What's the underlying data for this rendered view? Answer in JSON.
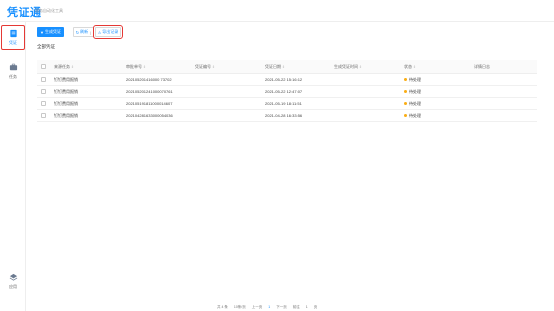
{
  "app": {
    "title": "凭证通",
    "subtitle": "财务自动化工具"
  },
  "sidebar": {
    "items": [
      {
        "label": "凭证",
        "icon": "voucher-icon",
        "active": true
      },
      {
        "label": "任务",
        "icon": "task-icon",
        "active": false
      },
      {
        "label": "应用",
        "icon": "app-icon",
        "active": false
      }
    ]
  },
  "toolbar": {
    "generate_label": "生成凭证",
    "refresh_label": "刷新",
    "refresh_separator": "|",
    "download_label": "导出记录"
  },
  "section": {
    "title": "全部凭证"
  },
  "table": {
    "columns": [
      "来源任务",
      "审批单号",
      "凭证编号",
      "凭证日期",
      "生成凭证时间",
      "状态",
      "详情日志"
    ],
    "rows": [
      {
        "source": "钉钉费用报销",
        "approval": "202105201416000 73702",
        "voucher": "",
        "date": "2021-05-22 15:16:12",
        "gentime": "",
        "status": "待处理",
        "log": ""
      },
      {
        "source": "钉钉费用报销",
        "approval": "202105201241000070761",
        "voucher": "",
        "date": "2021-05-22 12:47:07",
        "gentime": "",
        "status": "待处理",
        "log": ""
      },
      {
        "source": "钉钉费用报销",
        "approval": "202105191811000014607",
        "voucher": "",
        "date": "2021-05-19 18:11:51",
        "gentime": "",
        "status": "待处理",
        "log": ""
      },
      {
        "source": "钉钉费用报销",
        "approval": "202104281633000054036",
        "voucher": "",
        "date": "2021-04-28 16:33:56",
        "gentime": "",
        "status": "待处理",
        "log": ""
      }
    ]
  },
  "pagination": {
    "total": "共 4 条",
    "page_size": "10条/页",
    "prev": "上一页",
    "current": "1",
    "next": "下一页",
    "goto": "前往",
    "goto_page": "1",
    "page_unit": "页"
  },
  "colors": {
    "accent": "#1890ff",
    "highlight": "#e53935",
    "pending": "#faad14"
  }
}
